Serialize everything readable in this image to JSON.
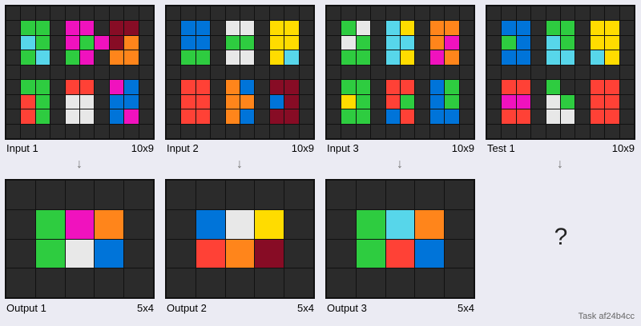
{
  "palette": {
    "0": "#2b2b2b",
    "1": "#0074d9",
    "2": "#ff4136",
    "3": "#2ecc40",
    "4": "#ffdc00",
    "5": "#aaaaaa",
    "6": "#f012be",
    "7": "#ff851b",
    "8": "#7fdbff",
    "9": "#870c25",
    "w": "#e8e8e8",
    "c": "#57d6ea"
  },
  "panels": [
    {
      "id": "input-1",
      "label": "Input 1",
      "dims": "10x9",
      "grid": [
        "0000000000",
        "0330660990",
        "0c30636970",
        "03c0360770",
        "0000000000",
        "0330220610",
        "0230ww0110",
        "0230ww0160",
        "0000000000"
      ]
    },
    {
      "id": "input-2",
      "label": "Input 2",
      "dims": "10x9",
      "grid": [
        "0000000000",
        "0110ww0440",
        "0110330440",
        "0330ww04c0",
        "0000000000",
        "0220710990",
        "0220770190",
        "0220710990",
        "0000000000"
      ]
    },
    {
      "id": "input-3",
      "label": "Input 3",
      "dims": "10x9",
      "grid": [
        "0000000000",
        "03w0c40770",
        "0w30cc0760",
        "0330c40670",
        "0000000000",
        "0330220130",
        "0430230130",
        "0330120110",
        "0000000000"
      ]
    },
    {
      "id": "test-1",
      "label": "Test 1",
      "dims": "10x9",
      "grid": [
        "0000000000",
        "0110330440",
        "0310c30440",
        "0110cc0c40",
        "0000000000",
        "0220300220",
        "0660w30220",
        "0220ww0220",
        "0000000000"
      ]
    }
  ],
  "outputs": [
    {
      "id": "output-1",
      "label": "Output 1",
      "dims": "5x4",
      "grid": [
        "00000",
        "03670",
        "03w10",
        "00000"
      ]
    },
    {
      "id": "output-2",
      "label": "Output 2",
      "dims": "5x4",
      "grid": [
        "00000",
        "01w40",
        "02790",
        "00000"
      ]
    },
    {
      "id": "output-3",
      "label": "Output 3",
      "dims": "5x4",
      "grid": [
        "00000",
        "03c70",
        "03210",
        "00000"
      ]
    }
  ],
  "unknown_output": "?",
  "arrow_glyph": "↓",
  "task_label": "Task af24b4cc"
}
